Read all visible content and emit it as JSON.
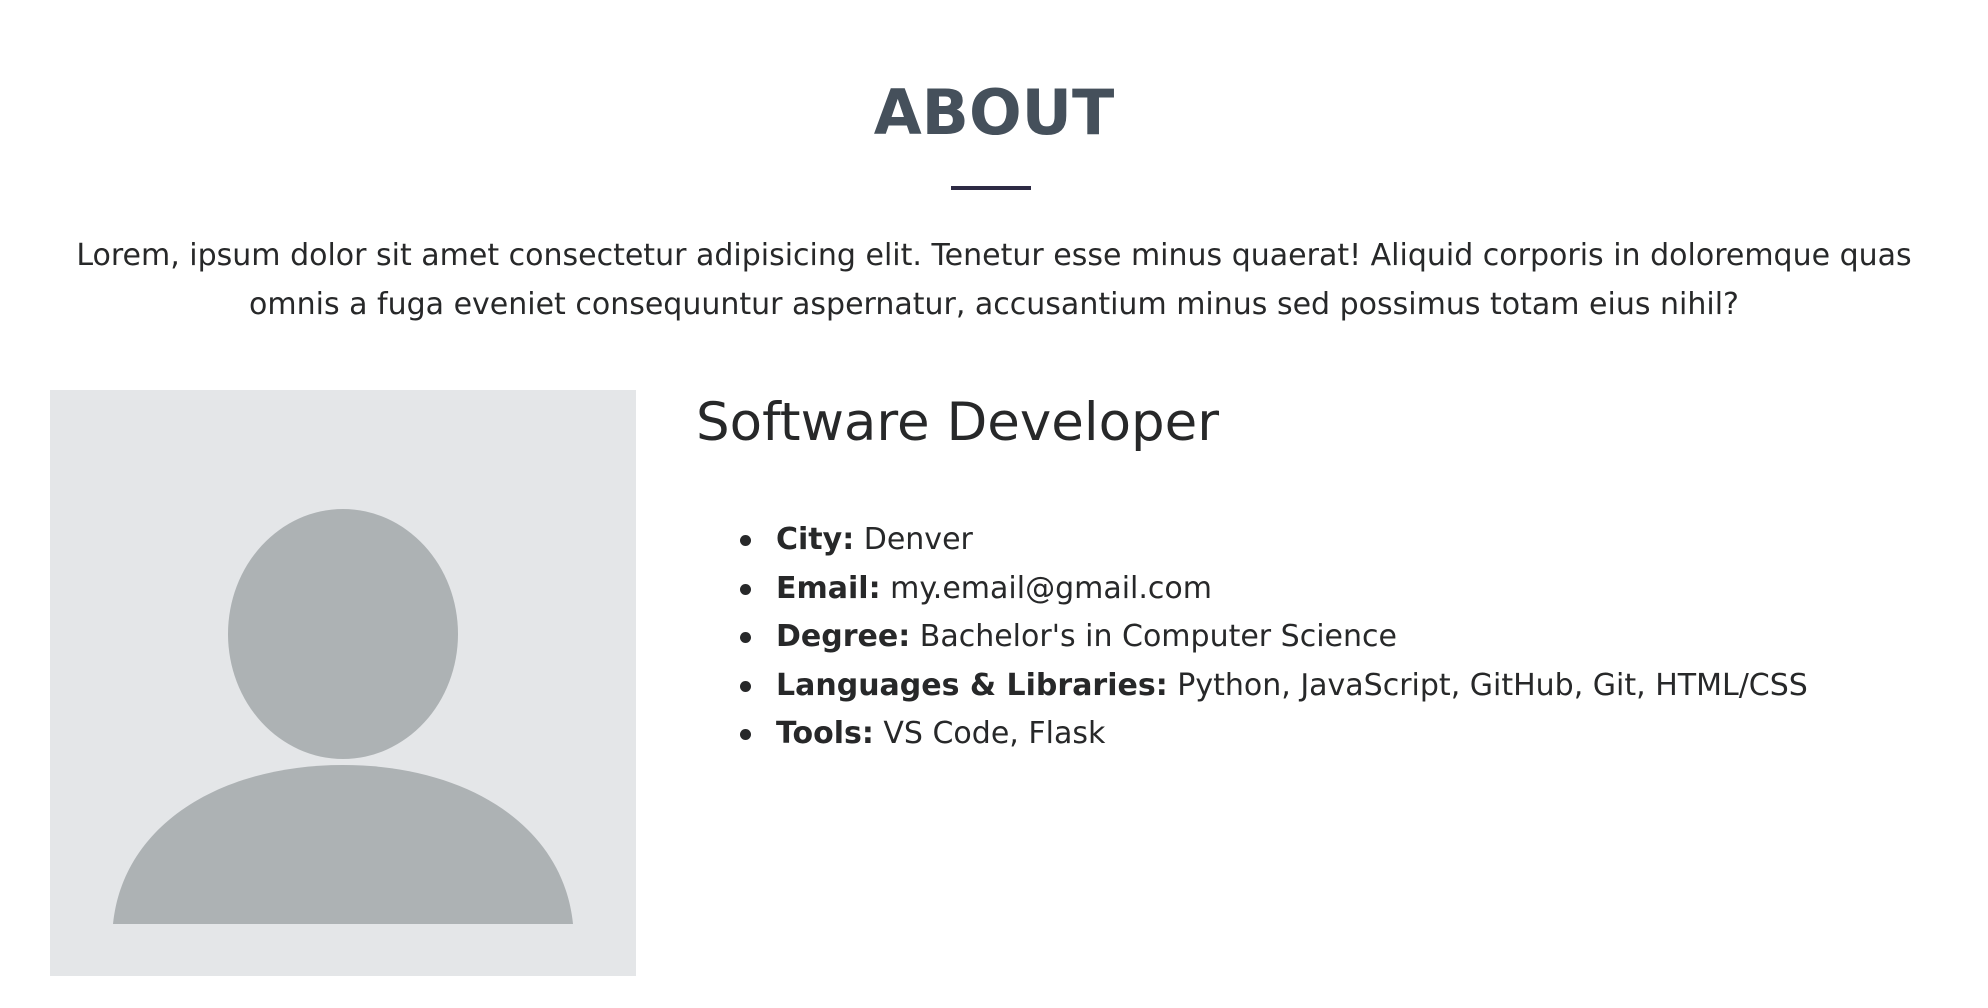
{
  "about": {
    "title": "ABOUT",
    "intro": "Lorem, ipsum dolor sit amet consectetur adipisicing elit. Tenetur esse minus quaerat! Aliquid corporis in doloremque quas omnis a fuga eveniet consequuntur aspernatur, accusantium minus sed possimus totam eius nihil?"
  },
  "profile": {
    "photo_icon": "person-placeholder-icon",
    "role": "Software Developer",
    "items": [
      {
        "label": "City:",
        "value": " Denver"
      },
      {
        "label": "Email:",
        "value": " my.email@gmail.com"
      },
      {
        "label": "Degree:",
        "value": " Bachelor's in Computer Science"
      },
      {
        "label": "Languages & Libraries:",
        "value": " Python, JavaScript, GitHub, Git, HTML/CSS"
      },
      {
        "label": "Tools:",
        "value": " VS Code, Flask"
      }
    ]
  },
  "colors": {
    "title": "#45505b",
    "underline": "#2d2a44",
    "text": "#272829",
    "photo_background": "#e4e6e8",
    "avatar_fill": "#adb2b4"
  }
}
